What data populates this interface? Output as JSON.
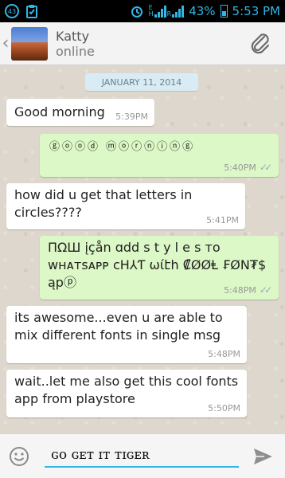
{
  "status_bar": {
    "notification_count": "43",
    "network_e": "E",
    "network_h": "H",
    "network_r": "R",
    "battery": "43%",
    "time": "5:53 PM"
  },
  "header": {
    "contact_name": "Katty",
    "presence": "online"
  },
  "chat": {
    "date": "JANUARY 11, 2014",
    "messages": [
      {
        "dir": "in",
        "text": "Good morning",
        "time": "5:39PM"
      },
      {
        "dir": "out",
        "text": "ⓖⓞⓞⓓ ⓜⓞⓡⓝⓘⓝⓖ",
        "time": "5:40PM",
        "ticks": "✓✓"
      },
      {
        "dir": "in",
        "text": "how did u get that letters in circles????",
        "time": "5:41PM"
      },
      {
        "dir": "out",
        "text": "ΠΩШ įçån ɑdd s t y l e s ᴛᴏ ᴡʜᴀᴛsᴀᴘᴘ cH⅄Ƭ ωίէհ ₡ØØⱠ ₣ØΝ₮$ ąpⓟ",
        "time": "5:48PM",
        "ticks": "✓✓"
      },
      {
        "dir": "in",
        "text": "its awesome...even u are able to mix different fonts in single msg",
        "time": "5:48PM"
      },
      {
        "dir": "in",
        "text": "wait..let me also get this cool fonts app from playstore",
        "time": "5:50PM"
      }
    ]
  },
  "composer": {
    "text": "ɢᴏ ɢᴇᴛ ɪᴛ ᴛɪɢᴇʀ"
  },
  "colors": {
    "accent": "#33b5e5",
    "outgoing_bubble": "#dcf8c6",
    "incoming_bubble": "#ffffff"
  },
  "icons": [
    "notification-badge-icon",
    "clipboard-check-icon",
    "alarm-icon",
    "signal-icon",
    "battery-icon",
    "back-icon",
    "paperclip-icon",
    "emoji-icon",
    "send-icon",
    "double-tick-icon"
  ]
}
